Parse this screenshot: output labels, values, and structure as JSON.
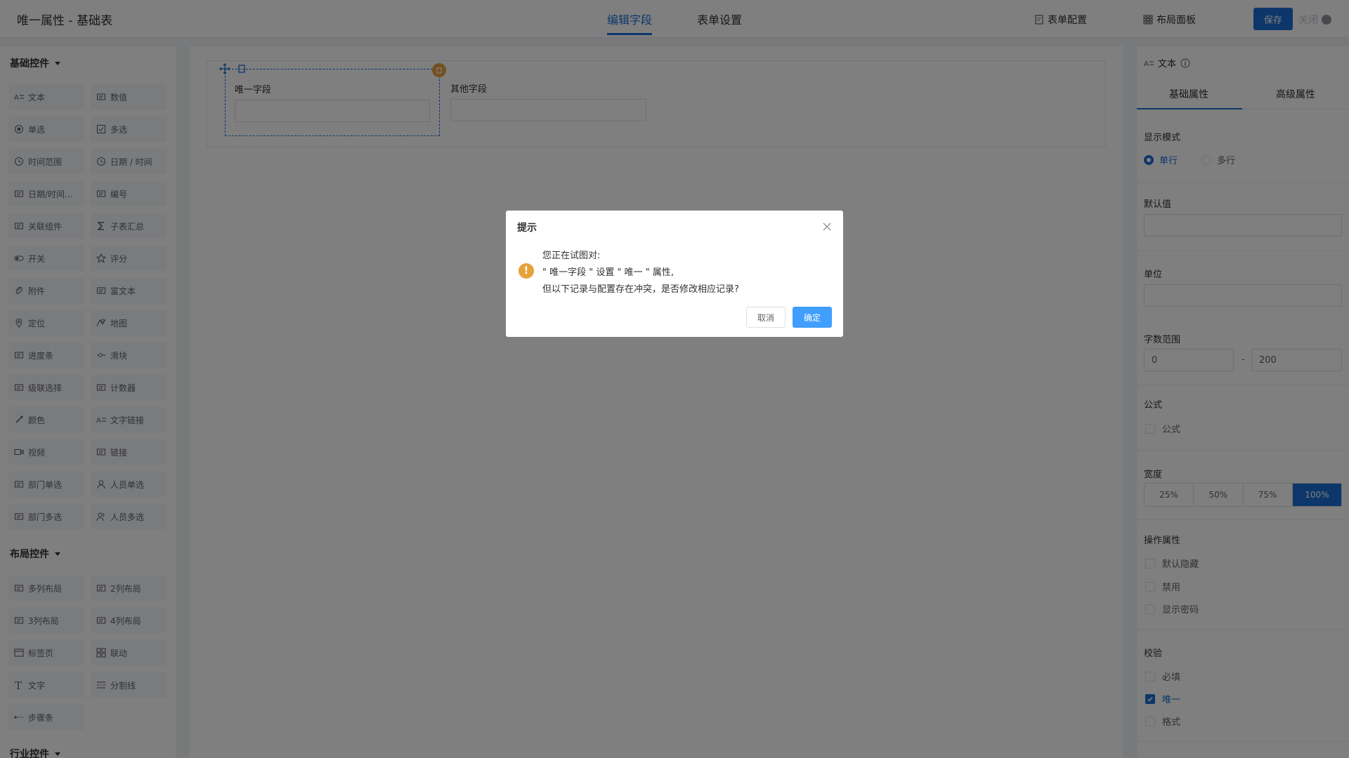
{
  "header": {
    "title": "唯一属性 - 基础表",
    "tabs": [
      {
        "label": "编辑字段"
      },
      {
        "label": "表单设置"
      }
    ],
    "form_config": "表单配置",
    "layout_panel": "布局面板",
    "save": "保存",
    "close": "关闭"
  },
  "sidebar": {
    "basic_title": "基础控件",
    "basic_items": [
      {
        "label": "文本",
        "icon": "text-icon"
      },
      {
        "label": "数值",
        "icon": "number-icon"
      },
      {
        "label": "单选",
        "icon": "radio-icon"
      },
      {
        "label": "多选",
        "icon": "checkbox-icon"
      },
      {
        "label": "时间范围",
        "icon": "clock-icon"
      },
      {
        "label": "日期 / 时间",
        "icon": "clock-icon"
      },
      {
        "label": "日期/时间...",
        "icon": "calendar-icon"
      },
      {
        "label": "编号",
        "icon": "serial-icon"
      },
      {
        "label": "关联组件",
        "icon": "link-component-icon"
      },
      {
        "label": "子表汇总",
        "icon": "sigma-icon"
      },
      {
        "label": "开关",
        "icon": "switch-icon"
      },
      {
        "label": "评分",
        "icon": "star-icon"
      },
      {
        "label": "附件",
        "icon": "paperclip-icon"
      },
      {
        "label": "富文本",
        "icon": "richtext-icon"
      },
      {
        "label": "定位",
        "icon": "location-icon"
      },
      {
        "label": "地图",
        "icon": "map-icon"
      },
      {
        "label": "进度条",
        "icon": "progress-icon"
      },
      {
        "label": "滑块",
        "icon": "slider-icon"
      },
      {
        "label": "级联选择",
        "icon": "cascader-icon"
      },
      {
        "label": "计数器",
        "icon": "counter-icon"
      },
      {
        "label": "颜色",
        "icon": "color-picker-icon"
      },
      {
        "label": "文字链接",
        "icon": "text-link-icon"
      },
      {
        "label": "视频",
        "icon": "video-icon"
      },
      {
        "label": "链接",
        "icon": "link-icon"
      },
      {
        "label": "部门单选",
        "icon": "department-icon"
      },
      {
        "label": "人员单选",
        "icon": "user-icon"
      },
      {
        "label": "部门多选",
        "icon": "department-multi-icon"
      },
      {
        "label": "人员多选",
        "icon": "users-icon"
      }
    ],
    "layout_title": "布局控件",
    "layout_items": [
      {
        "label": "多列布局",
        "icon": "columns-icon"
      },
      {
        "label": "2列布局",
        "icon": "two-column-icon"
      },
      {
        "label": "3列布局",
        "icon": "three-column-icon"
      },
      {
        "label": "4列布局",
        "icon": "four-column-icon"
      },
      {
        "label": "标签页",
        "icon": "tabs-icon"
      },
      {
        "label": "联动",
        "icon": "grid-icon"
      },
      {
        "label": "文字",
        "icon": "text-t-icon"
      },
      {
        "label": "分割线",
        "icon": "divider-icon"
      },
      {
        "label": "步骤条",
        "icon": "steps-icon"
      }
    ],
    "industry_title": "行业控件"
  },
  "canvas": {
    "field1_label": "唯一字段",
    "field2_label": "其他字段"
  },
  "panel": {
    "title": "文本",
    "tabs": [
      {
        "label": "基础属性"
      },
      {
        "label": "高级属性"
      }
    ],
    "display_mode": "显示模式",
    "single": "单行",
    "multi": "多行",
    "default_value": "默认值",
    "unit": "单位",
    "char_range": "字数范围",
    "range_min": "0",
    "range_sep": "-",
    "range_max": "200",
    "formula_title": "公式",
    "formula_cb": "公式",
    "width_title": "宽度",
    "widths": [
      "25%",
      "50%",
      "75%",
      "100%"
    ],
    "ops_title": "操作属性",
    "ops": [
      "默认隐藏",
      "禁用",
      "显示密码"
    ],
    "validation_title": "校验",
    "validations": [
      "必填",
      "唯一",
      "格式"
    ]
  },
  "dialog": {
    "title": "提示",
    "line1": "您正在试图对:",
    "line2": "\" 唯一字段 \" 设置 \" 唯一 \" 属性,",
    "line3": "但以下记录与配置存在冲突，是否修改相应记录?",
    "cancel": "取消",
    "confirm": "确定"
  },
  "colors": {
    "accent": "#1a6fd4",
    "warning": "#e6a23c",
    "confirm": "#409eff"
  }
}
